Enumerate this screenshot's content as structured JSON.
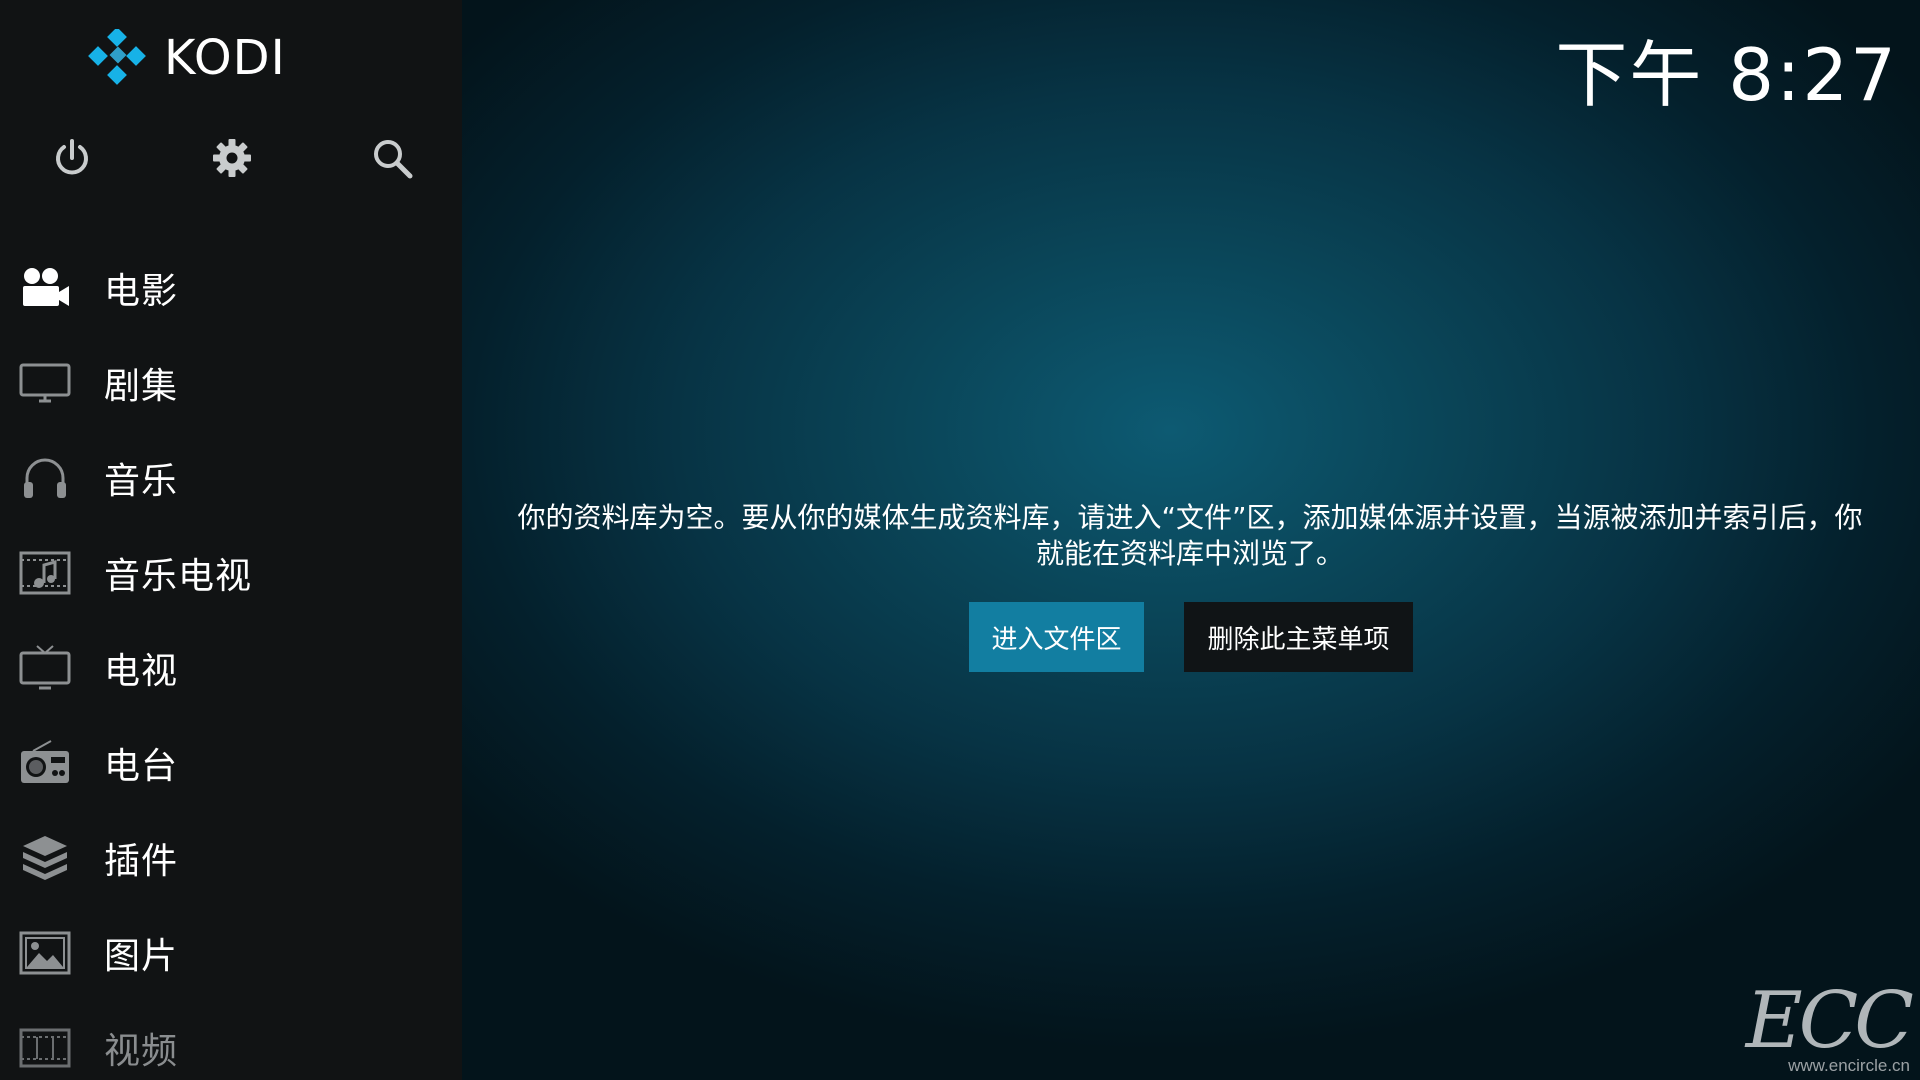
{
  "app": {
    "name": "KODI"
  },
  "clock": {
    "time": "下午 8:27"
  },
  "top_icons": [
    "power-icon",
    "gear-icon",
    "search-icon"
  ],
  "menu": {
    "items": [
      {
        "label": "电影",
        "icon": "movies-icon"
      },
      {
        "label": "剧集",
        "icon": "tv-shows-icon"
      },
      {
        "label": "音乐",
        "icon": "headphones-icon"
      },
      {
        "label": "音乐电视",
        "icon": "music-video-icon"
      },
      {
        "label": "电视",
        "icon": "live-tv-icon"
      },
      {
        "label": "电台",
        "icon": "radio-icon"
      },
      {
        "label": "插件",
        "icon": "addons-icon"
      },
      {
        "label": "图片",
        "icon": "pictures-icon"
      },
      {
        "label": "视频",
        "icon": "videos-icon"
      }
    ]
  },
  "content": {
    "message": "你的资料库为空。要从你的媒体生成资料库，请进入“文件”区，添加媒体源并设置，当源被添加并索引后，你就能在资料库中浏览了。",
    "enter_files_button": "进入文件区",
    "remove_item_button": "删除此主菜单项"
  },
  "watermark": {
    "logo": "ECC",
    "url": "www.encircle.cn"
  },
  "colors": {
    "sidebar": "#111314",
    "accent": "#127ea1",
    "logo_blue": "#17b2e7"
  }
}
